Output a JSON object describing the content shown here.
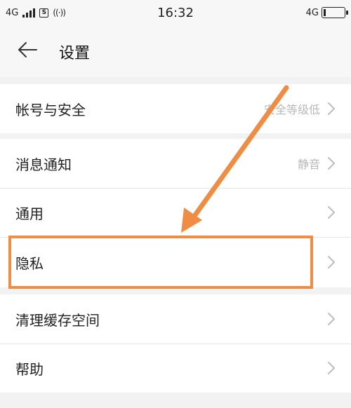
{
  "status_bar": {
    "network_left": "4G",
    "sim_label": "S",
    "hotspot_glyph": "((·))",
    "time": "16:32",
    "network_right": "4G",
    "battery_level": 0.1
  },
  "header": {
    "title": "设置"
  },
  "settings": {
    "account": {
      "label": "帐号与安全",
      "value": "安全等级低"
    },
    "notifications": {
      "label": "消息通知",
      "value": "静音"
    },
    "general": {
      "label": "通用"
    },
    "privacy": {
      "label": "隐私"
    },
    "clear_cache": {
      "label": "清理缓存空间"
    },
    "help": {
      "label": "帮助"
    }
  },
  "annotation": {
    "color": "#ef8d45",
    "highlighted_item": "隐私"
  }
}
